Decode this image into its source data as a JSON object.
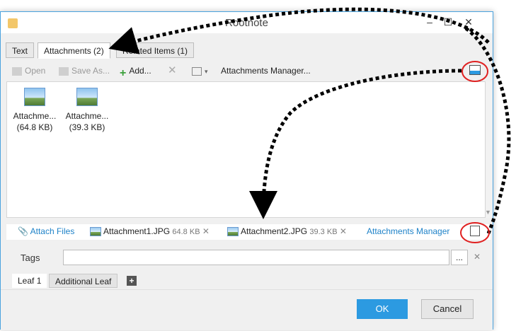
{
  "window": {
    "title": "Rootnote"
  },
  "tabs": [
    {
      "label": "Text"
    },
    {
      "label": "Attachments (2)"
    },
    {
      "label": "Related Items  (1)"
    }
  ],
  "toolbar": {
    "open": "Open",
    "save_as": "Save As...",
    "add": "Add...",
    "manager": "Attachments Manager..."
  },
  "files": [
    {
      "name": "Attachme...",
      "size": "(64.8 KB)"
    },
    {
      "name": "Attachme...",
      "size": "(39.3 KB)"
    }
  ],
  "attach_bar": {
    "attach_files": "Attach Files",
    "items": [
      {
        "name": "Attachment1.JPG",
        "size": "64.8 KB"
      },
      {
        "name": "Attachment2.JPG",
        "size": "39.3 KB"
      }
    ],
    "manager": "Attachments Manager"
  },
  "tags": {
    "label": "Tags",
    "value": "",
    "ellipsis": "..."
  },
  "leaves": [
    {
      "label": "Leaf 1"
    },
    {
      "label": "Additional Leaf"
    }
  ],
  "buttons": {
    "ok": "OK",
    "cancel": "Cancel"
  },
  "colors": {
    "accent": "#2c9ae1",
    "link": "#1e82c8",
    "highlight_circle": "#e02020"
  },
  "icons": [
    "app-icon",
    "open-icon",
    "save-icon",
    "add-icon",
    "delete-icon",
    "view-icon",
    "manager-icon",
    "paperclip-icon",
    "image-icon",
    "plus-icon"
  ]
}
